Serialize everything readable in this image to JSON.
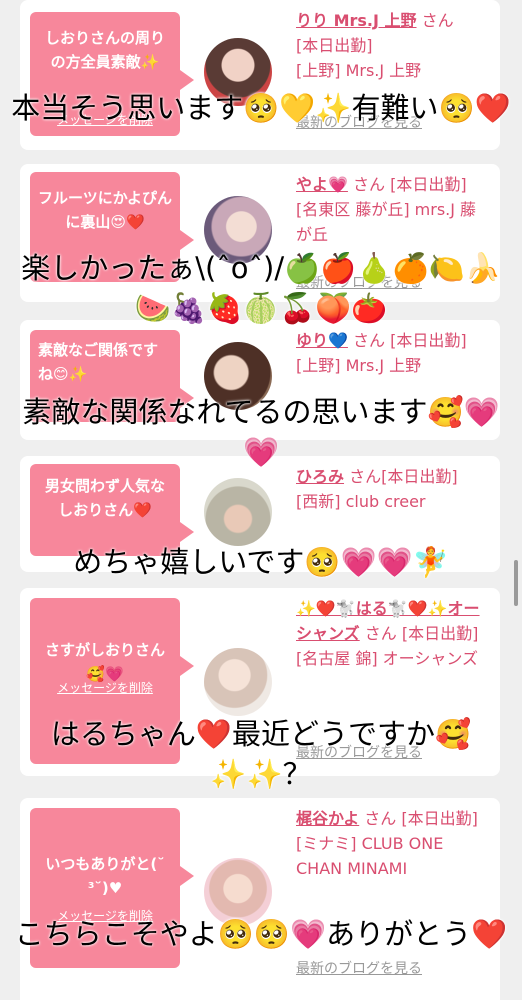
{
  "colors": {
    "accent": "#f7879b",
    "link": "#d94e70",
    "background": "#efefef"
  },
  "delete_label": "メッセージを削除",
  "blog_label": "最新のブログを見る",
  "honorific": "さん",
  "items": [
    {
      "message": "しおりさんの周りの方全員素敵✨",
      "name": "りり Mrs.J 上野",
      "status": "[本日出勤]",
      "shop": "[上野] Mrs.J 上野",
      "caption": "本当そう思います🥺💛✨有難い🥺❤️"
    },
    {
      "message": "フルーツにかよぴんに裏山😍❤️",
      "name": "やよ💗",
      "status": "[本日出勤]",
      "shop": "[名東区 藤が丘] mrs.J 藤が丘",
      "caption": "楽しかったぁ\\(ˆoˆ)/🍏🍎🍐🍊🍋🍌🍉🍇🍓🍈🍒🍑🍅"
    },
    {
      "message": "素敵なご関係ですね😊✨",
      "name": "ゆり💙",
      "status": "[本日出勤]",
      "shop": "[上野] Mrs.J 上野",
      "caption": "素敵な関係なれてるの思います🥰💗💗"
    },
    {
      "message": "男女問わず人気なしおりさん❤️",
      "name": "ひろみ",
      "status": "[本日出勤]",
      "shop": "[西新] club creer",
      "caption": "めちゃ嬉しいです🥺💗💗🧚"
    },
    {
      "message": "さすがしおりさん🥰💗",
      "name": "✨❤️🐩はる🐩❤️✨オーシャンズ",
      "status": "[本日出勤]",
      "shop": "[名古屋 錦] オーシャンズ",
      "caption": "はるちゃん❤️最近どうですか🥰✨✨？"
    },
    {
      "message": "いつもありがと(˘ ³˘)♥",
      "name": "梶谷かよ",
      "status": "[本日出勤]",
      "shop": "[ミナミ] CLUB ONE CHAN MINAMI",
      "caption": "こちらこそやよ🥺🥺💗ありがとう❤️"
    }
  ]
}
